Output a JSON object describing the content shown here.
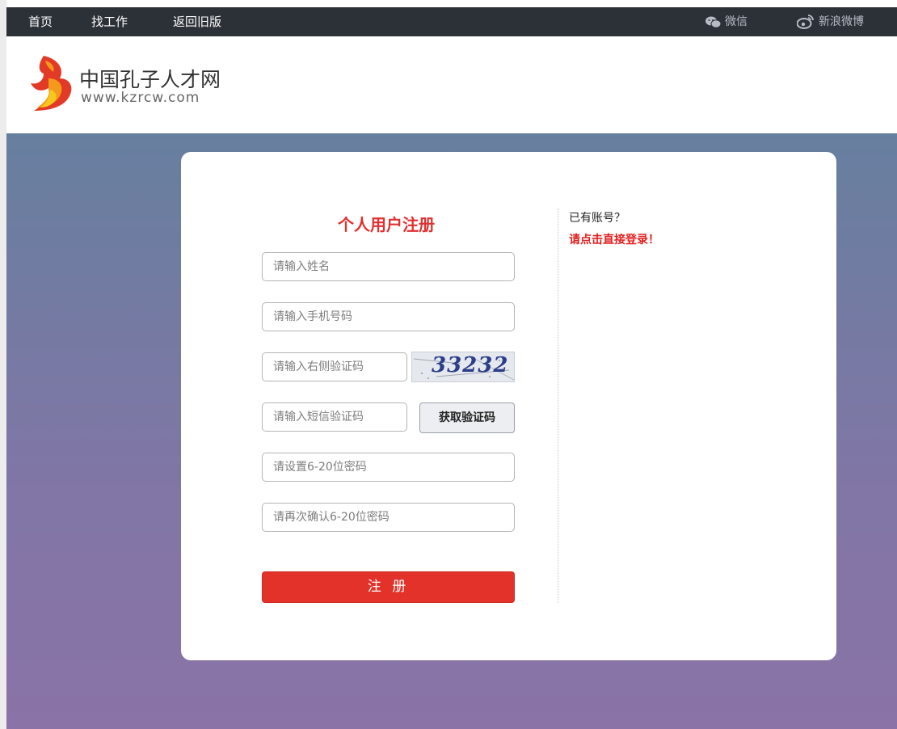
{
  "topbar": {
    "nav": [
      {
        "label": "首页"
      },
      {
        "label": "找工作"
      },
      {
        "label": "返回旧版"
      }
    ],
    "social": [
      {
        "label": "微信",
        "icon": "wechat-icon"
      },
      {
        "label": "新浪微博",
        "icon": "weibo-icon"
      }
    ]
  },
  "logo": {
    "name": "中国孔子人才网",
    "url": "www.kzrcw.com",
    "colors": {
      "red": "#e23a26",
      "orange": "#f39a1d",
      "yellow": "#f7c81b"
    }
  },
  "form": {
    "title": "个人用户注册",
    "name_placeholder": "请输入姓名",
    "phone_placeholder": "请输入手机号码",
    "captcha_placeholder": "请输入右侧验证码",
    "captcha_value": "33232",
    "sms_placeholder": "请输入短信验证码",
    "sms_button": "获取验证码",
    "password_placeholder": "请设置6-20位密码",
    "password_confirm_placeholder": "请再次确认6-20位密码",
    "submit": "注 册"
  },
  "login": {
    "prompt": "已有账号？",
    "link": "请点击直接登录！"
  },
  "colors": {
    "accent": "#e33229",
    "topbar": "#2c3138",
    "bg_top": "#677f9f",
    "bg_bottom": "#8a73a6"
  }
}
